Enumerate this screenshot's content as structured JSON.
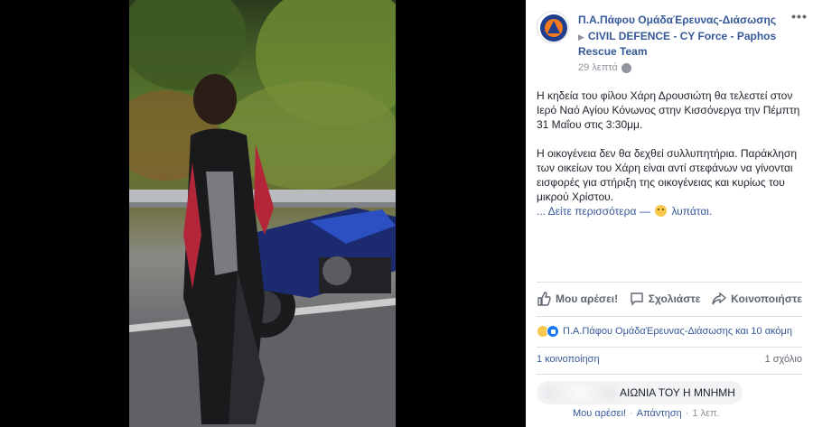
{
  "header": {
    "page_title": "Π.Α.Πάφου ΟμάδαΈρευνας-Διάσωσης",
    "group_name": "CIVIL DEFENCE - CY Force - Paphos Rescue Team",
    "time": "29 λεπτά",
    "more_label": "•••",
    "audience_icon": "globe-icon",
    "avatar_icon": "civil-defence-logo"
  },
  "post": {
    "paragraph_1": "Η κηδεία του φίλου Χάρη Δρουσιώτη θα τελεστεί στον Ιερό Ναό Αγίου Κόνωνος στην Κισσόνεργα την Πέμπτη 31 Μαΐου στις 3:30μμ.",
    "paragraph_2": "Η οικογένεια δεν θα δεχθεί συλλυπητήρια. Παράκληση των οικείων του Χάρη είναι αντί στεφάνων να γίνονται εισφορές για στήριξη της οικογένειας και κυρίως του μικρού Χρίστου.",
    "see_more": "... Δείτε περισσότερα",
    "feeling_dash": "—",
    "feeling_text": "λυπάται."
  },
  "actions": {
    "like": "Μου αρέσει!",
    "comment": "Σχολιάστε",
    "share": "Κοινοποιήστε"
  },
  "reactions": {
    "summary": "Π.Α.Πάφου ΟμάδαΈρευνας-Διάσωσης και 10 ακόμη"
  },
  "stats": {
    "shares": "1 κοινοποίηση",
    "comments": "1 σχόλιο"
  },
  "comment": {
    "text": "ΑΙΩΝΙΑ ΤΟΥ Η ΜΝΗΜΗ",
    "like": "Μου αρέσει!",
    "sep1": "·",
    "reply": "Απάντηση",
    "sep2": "·",
    "time": "1 λεπ."
  },
  "colors": {
    "link": "#365899",
    "muted": "#90949c",
    "text": "#1d2129",
    "action": "#606770"
  }
}
